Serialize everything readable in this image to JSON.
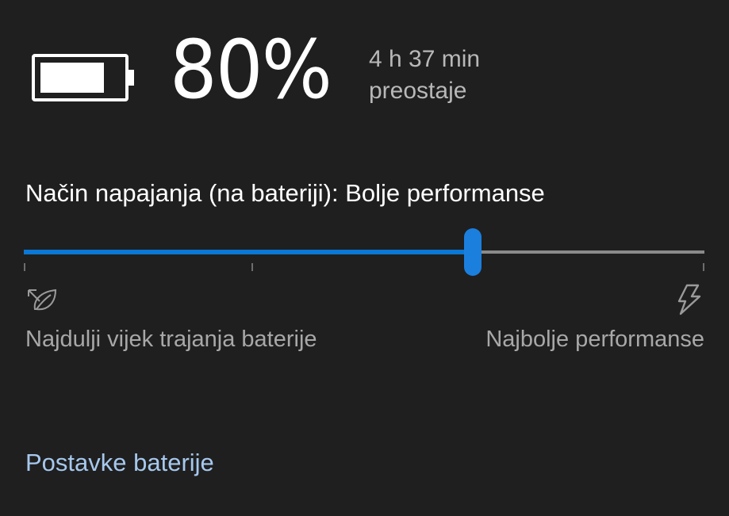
{
  "battery": {
    "percent_text": "80%",
    "charge_fraction": 0.8,
    "time_remaining": "4 h 37 min",
    "remaining_suffix": "preostaje"
  },
  "power_mode": {
    "label": "Način napajanja (na bateriji): Bolje performanse",
    "slider_value": 0.66,
    "tick_positions": [
      0.0,
      0.335,
      1.0
    ],
    "min_label": "Najdulji vijek trajanja baterije",
    "max_label": "Najbolje performanse",
    "min_icon": "leaf-icon",
    "max_icon": "lightning-bolt-icon"
  },
  "footer": {
    "link_label": "Postavke baterije"
  },
  "colors": {
    "background": "#1f1f1f",
    "accent": "#0a78d4",
    "link": "#a6c8ee",
    "secondary_text": "#a8a8a8"
  }
}
